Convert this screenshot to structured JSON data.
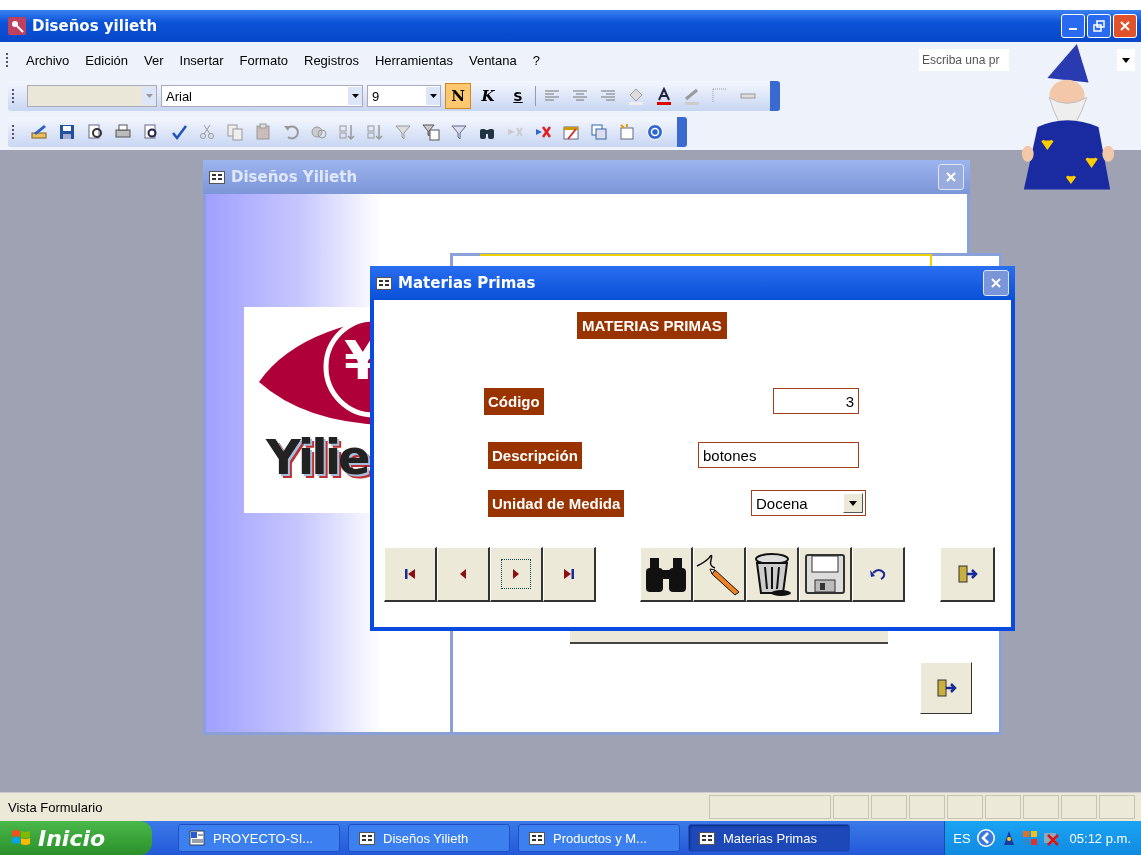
{
  "window": {
    "title": "Diseños yilieth"
  },
  "menu": [
    {
      "label": "Archivo"
    },
    {
      "label": "Edición"
    },
    {
      "label": "Ver"
    },
    {
      "label": "Insertar"
    },
    {
      "label": "Formato"
    },
    {
      "label": "Registros"
    },
    {
      "label": "Herramientas"
    },
    {
      "label": "Ventana"
    },
    {
      "label": "?"
    }
  ],
  "help_search": {
    "placeholder": "Escriba una pr"
  },
  "format_toolbar": {
    "font": "Arial",
    "size": "9",
    "styles": [
      {
        "label": "N",
        "on": true
      },
      {
        "label": "K",
        "on": false
      },
      {
        "label": "S",
        "on": false
      }
    ]
  },
  "back_window": {
    "title": "Diseños Yilieth",
    "logo_symbol": "¥",
    "logo_text": "Yilie"
  },
  "form": {
    "title": "Materias Primas",
    "heading": "MATERIAS PRIMAS",
    "fields": [
      {
        "kind": "number",
        "label": "Código",
        "value": "3"
      },
      {
        "kind": "text",
        "label": "Descripción",
        "value": "botones"
      },
      {
        "kind": "combo",
        "label": "Unidad de Medida",
        "value": "Docena"
      }
    ],
    "nav": [
      {
        "kind": "first",
        "focused": false
      },
      {
        "kind": "prev",
        "focused": false
      },
      {
        "kind": "next",
        "focused": true
      },
      {
        "kind": "last",
        "focused": false
      }
    ]
  },
  "status_bar": {
    "text": "Vista Formulario"
  },
  "taskbar": {
    "start": "Inicio",
    "tasks": [
      {
        "label": "PROYECTO-SI...",
        "kind": "doc",
        "selected": false
      },
      {
        "label": "Diseños Yilieth",
        "kind": "form",
        "selected": false
      },
      {
        "label": "Productos y M...",
        "kind": "form",
        "selected": false
      },
      {
        "label": "Materias Primas",
        "kind": "form",
        "selected": true
      }
    ],
    "language": "ES",
    "clock": "05:12 p.m."
  }
}
